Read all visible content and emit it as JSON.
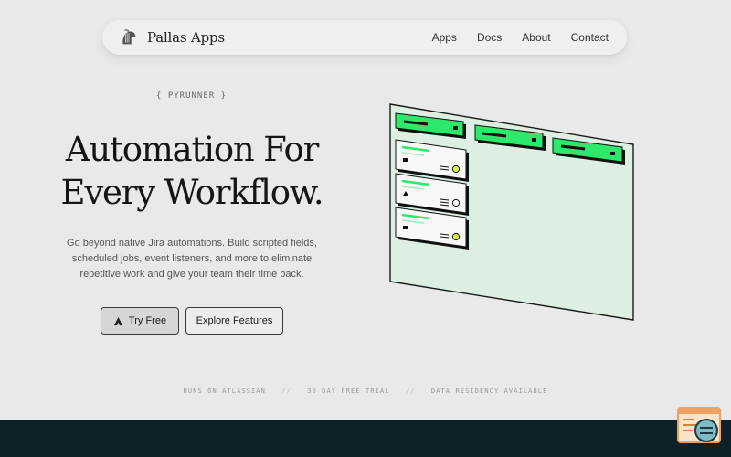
{
  "nav": {
    "brand_name": "Pallas Apps",
    "logo_icon": "greek-helmet-icon",
    "links": [
      "Apps",
      "Docs",
      "About",
      "Contact"
    ]
  },
  "hero": {
    "eyebrow": "{ PYRUNNER }",
    "title_line1": "Automation For",
    "title_line2": "Every Workflow.",
    "description": "Go beyond native Jira automations. Build scripted fields, scheduled jobs, event listeners, and more to eliminate repetitive work and give your team their time back."
  },
  "buttons": {
    "primary_label": "Try Free",
    "primary_icon": "atlassian-icon",
    "secondary_label": "Explore Features"
  },
  "trust_items": [
    "RUNS ON ATLASSIAN",
    "30 DAY FREE TRIAL",
    "DATA RESIDENCY AVAILABLE"
  ],
  "trust_separator": "//",
  "colors": {
    "background": "#e9e9e9",
    "accent_green": "#2ee86b",
    "board_bg": "#dcefe2",
    "footer_dark": "#0f2128",
    "widget_orange": "#f0a060"
  },
  "illustration": {
    "icon": "isometric-kanban-board-illustration"
  },
  "widget": {
    "icon": "code-chat-widget-icon"
  }
}
